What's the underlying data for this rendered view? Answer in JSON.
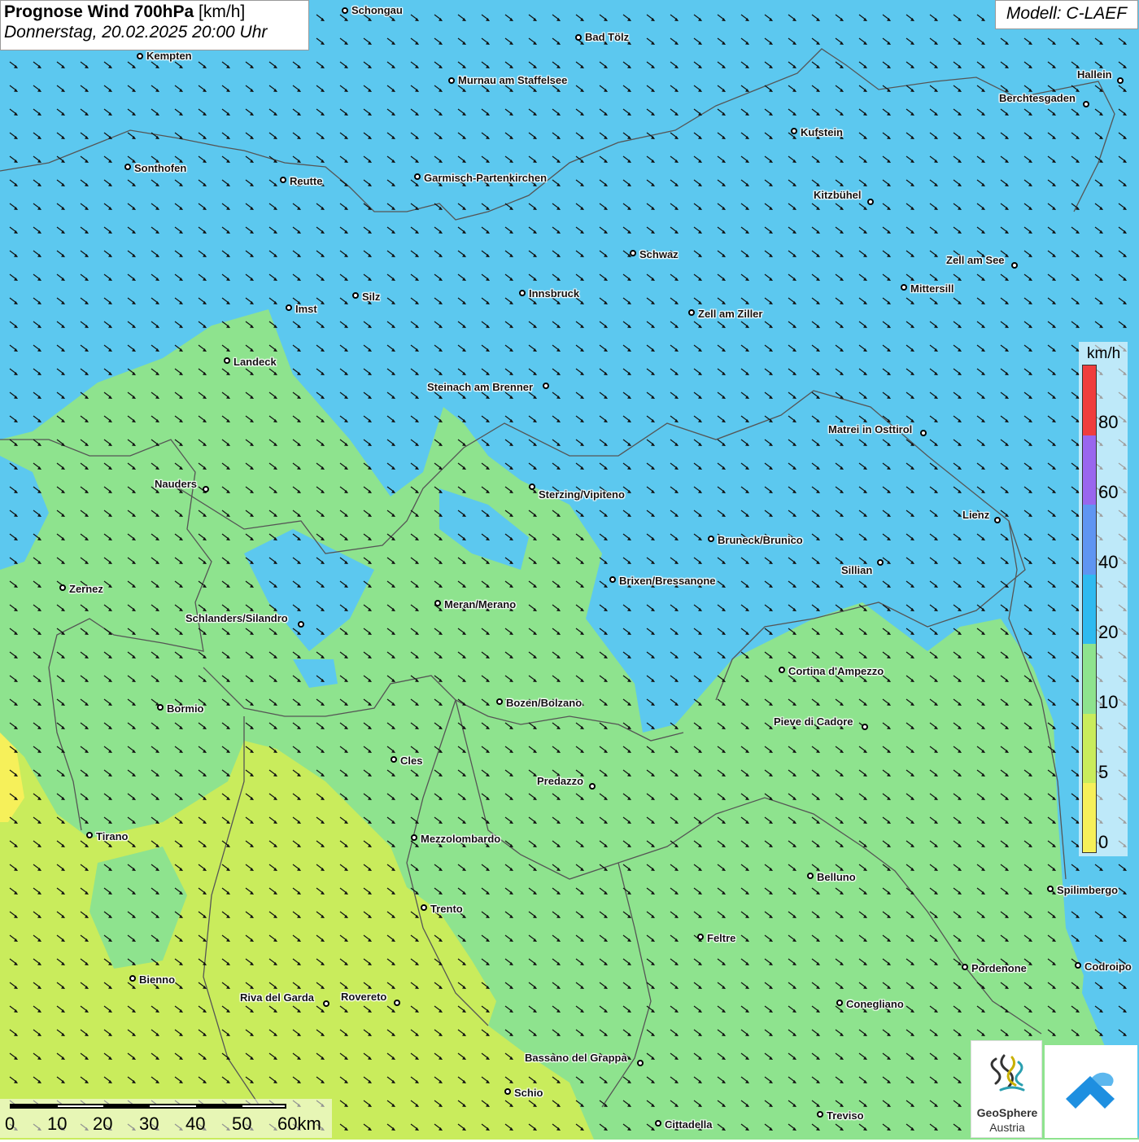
{
  "header": {
    "title_bold": "Prognose Wind 700hPa",
    "title_unit": "[km/h]",
    "datetime": "Donnerstag, 20.02.2025 20:00 Uhr",
    "model": "Modell: C-LAEF"
  },
  "colors": {
    "wind_20_40": "#5cc8ef",
    "wind_10_20": "#8ee38e",
    "wind_5_10": "#c9ec5c",
    "wind_0_5": "#f6f05a",
    "wind_40_60": "#5f95f2",
    "wind_60_80": "#9966ee",
    "wind_80_plus": "#ef3d3d",
    "border_line": "#555555",
    "arrow": "#111111"
  },
  "legend": {
    "unit": "km/h",
    "ticks": [
      "80",
      "60",
      "40",
      "20",
      "10",
      "5",
      "0"
    ],
    "segments": [
      {
        "range": "80+",
        "color": "#ef3d3d"
      },
      {
        "range": "60-80",
        "color": "#9966ee"
      },
      {
        "range": "40-60",
        "color": "#5f95f2"
      },
      {
        "range": "20-40",
        "color": "#2fbaf0"
      },
      {
        "range": "10-20",
        "color": "#8ee38e"
      },
      {
        "range": "5-10",
        "color": "#c9ec5c"
      },
      {
        "range": "0-5",
        "color": "#f6f05a"
      }
    ]
  },
  "wind": {
    "direction": "north-west to south-east",
    "icon": "wind-arrow-icon"
  },
  "cities": [
    {
      "name": "Schongau"
    },
    {
      "name": "Bad Tölz"
    },
    {
      "name": "Kempten"
    },
    {
      "name": "Murnau am Staffelsee"
    },
    {
      "name": "Hallein"
    },
    {
      "name": "Berchtesgaden"
    },
    {
      "name": "Kufstein"
    },
    {
      "name": "Sonthofen"
    },
    {
      "name": "Reutte"
    },
    {
      "name": "Garmisch-Partenkirchen"
    },
    {
      "name": "Kitzbühel"
    },
    {
      "name": "Schwaz"
    },
    {
      "name": "Zell am See"
    },
    {
      "name": "Mittersill"
    },
    {
      "name": "Innsbruck"
    },
    {
      "name": "Silz"
    },
    {
      "name": "Imst"
    },
    {
      "name": "Zell am Ziller"
    },
    {
      "name": "Landeck"
    },
    {
      "name": "Steinach am Brenner"
    },
    {
      "name": "Matrei in Osttirol"
    },
    {
      "name": "Nauders"
    },
    {
      "name": "Sterzing/Vipiteno"
    },
    {
      "name": "Lienz"
    },
    {
      "name": "Bruneck/Brunico"
    },
    {
      "name": "Sillian"
    },
    {
      "name": "Zernez"
    },
    {
      "name": "Brixen/Bressanone"
    },
    {
      "name": "Meran/Merano"
    },
    {
      "name": "Schlanders/Silandro"
    },
    {
      "name": "Cortina d'Ampezzo"
    },
    {
      "name": "Bozen/Bolzano"
    },
    {
      "name": "Bormio"
    },
    {
      "name": "Pieve di Cadore"
    },
    {
      "name": "Cles"
    },
    {
      "name": "Predazzo"
    },
    {
      "name": "Tirano"
    },
    {
      "name": "Mezzolombardo"
    },
    {
      "name": "Belluno"
    },
    {
      "name": "Spilimbergo"
    },
    {
      "name": "Trento"
    },
    {
      "name": "Feltre"
    },
    {
      "name": "Pordenone"
    },
    {
      "name": "Codroipo"
    },
    {
      "name": "Bienno"
    },
    {
      "name": "Riva del Garda"
    },
    {
      "name": "Rovereto"
    },
    {
      "name": "Conegliano"
    },
    {
      "name": "Bassano del Grappa"
    },
    {
      "name": "Schio"
    },
    {
      "name": "Treviso"
    },
    {
      "name": "Cittadella"
    }
  ],
  "scale": {
    "labels": [
      "0",
      "10",
      "20",
      "30",
      "40",
      "50",
      "60km"
    ]
  },
  "logos": {
    "geosphere_name": "GeoSphere",
    "geosphere_sub": "Austria",
    "geosphere_icon": "geosphere-logo-icon",
    "app_icon": "app-logo-icon"
  }
}
